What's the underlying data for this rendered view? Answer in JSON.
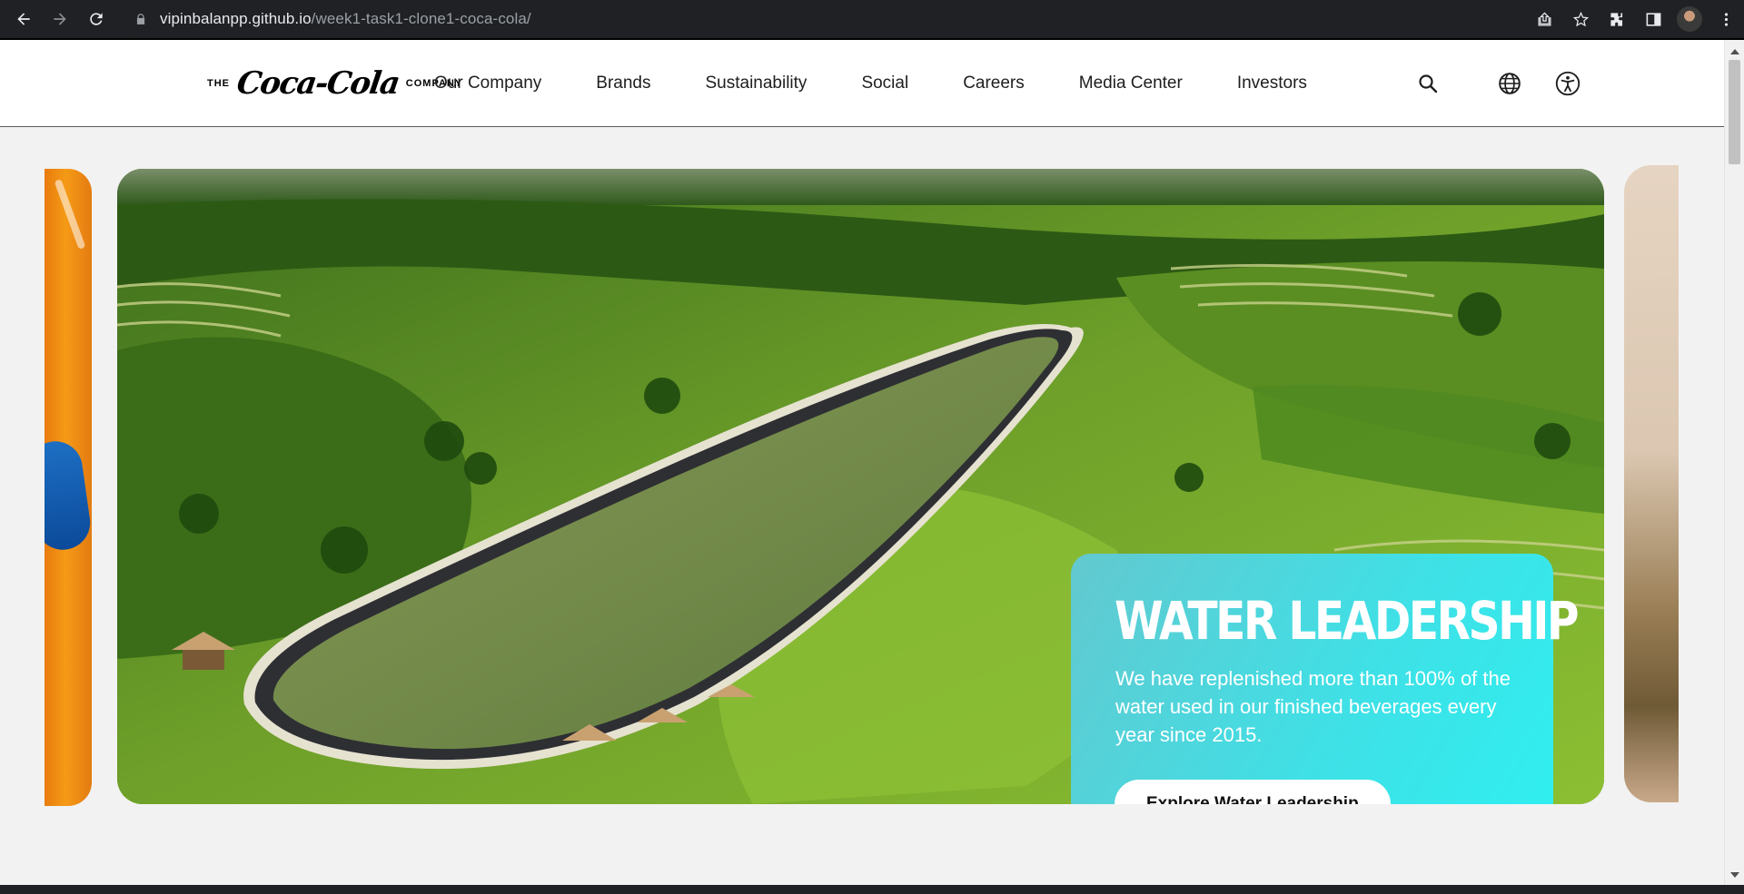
{
  "browser": {
    "url_host": "vipinbalanpp.github.io",
    "url_path": "/week1-task1-clone1-coca-cola/"
  },
  "header": {
    "logo": {
      "pre": "THE",
      "script": "Coca-Cola",
      "post": "COMPANY"
    },
    "nav": [
      {
        "label": "Our Company"
      },
      {
        "label": "Brands"
      },
      {
        "label": "Sustainability"
      },
      {
        "label": "Social"
      },
      {
        "label": "Careers"
      },
      {
        "label": "Media Center"
      },
      {
        "label": "Investors"
      }
    ],
    "icons": [
      "search-icon",
      "globe-icon",
      "accessibility-icon"
    ]
  },
  "hero": {
    "title": "WATER LEADERSHIP",
    "description": "We have replenished more than 100% of the water used in our finished beverages every year since 2015.",
    "cta_label": "Explore Water Leadership"
  },
  "colors": {
    "card_gradient_start": "#63c8cf",
    "card_gradient_end": "#2ef0f0",
    "header_bg": "#ffffff",
    "page_bg": "#f2f2f2"
  }
}
